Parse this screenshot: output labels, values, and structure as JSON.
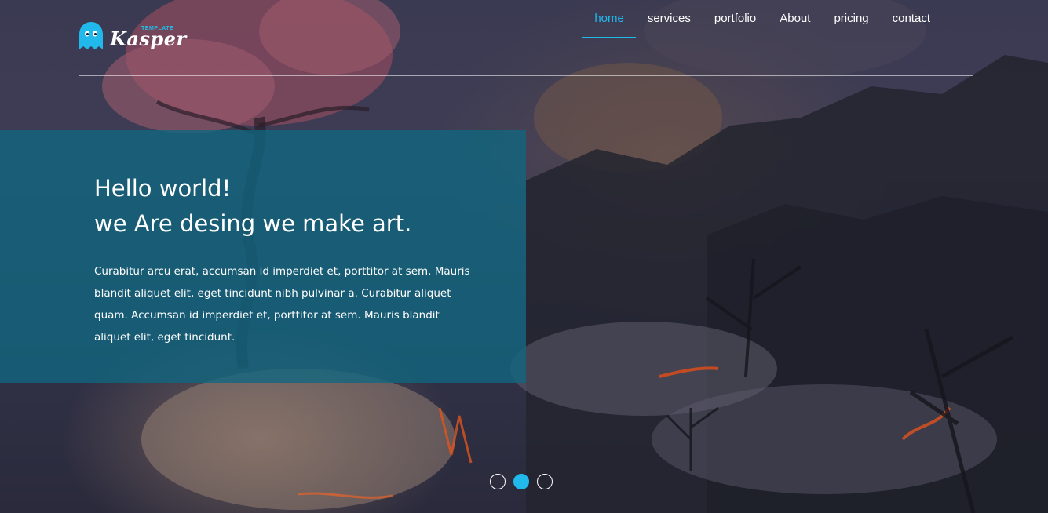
{
  "brand": {
    "name": "Kasper",
    "tagline": "TEMPLATE",
    "logo_icon": "ghost-icon",
    "accent_color": "#21b8ec"
  },
  "nav": {
    "items": [
      {
        "label": "home",
        "active": true
      },
      {
        "label": "services",
        "active": false
      },
      {
        "label": "portfolio",
        "active": false
      },
      {
        "label": "About",
        "active": false
      },
      {
        "label": "pricing",
        "active": false
      },
      {
        "label": "contact",
        "active": false
      }
    ]
  },
  "hero": {
    "title_line1": "Hello world!",
    "title_line2": "we Are desing we make art.",
    "paragraph": "Curabitur arcu erat, accumsan id imperdiet et, porttitor at sem. Mauris blandit aliquet elit, eget tincidunt nibh pulvinar a. Curabitur aliquet quam. Accumsan id imperdiet et, porttitor at sem. Mauris blandit aliquet elit, eget tincidunt.",
    "panel_color": "#106680"
  },
  "slider": {
    "total_slides": 3,
    "active_index": 1
  }
}
